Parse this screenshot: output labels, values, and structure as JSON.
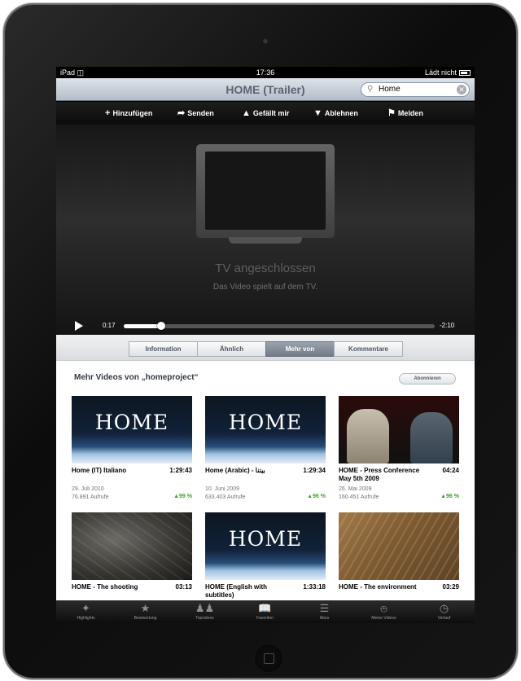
{
  "status": {
    "carrier": "iPad",
    "time": "17:36",
    "charging": "Lädt nicht"
  },
  "nav": {
    "title": "HOME (Trailer)",
    "search_value": "Home"
  },
  "actions": [
    "Hinzufügen",
    "Senden",
    "Gefällt mir",
    "Ablehnen",
    "Melden"
  ],
  "player": {
    "tv_title": "TV angeschlossen",
    "tv_subtitle": "Das Video spielt auf dem TV.",
    "elapsed": "0:17",
    "remaining": "-2:10",
    "progress": 0.12
  },
  "segments": {
    "labels": [
      "Information",
      "Ähnlich",
      "Mehr von",
      "Kommentare"
    ],
    "active": "Mehr von"
  },
  "section": {
    "title": "Mehr Videos von „homeproject“",
    "subscribe": "Abonnieren"
  },
  "videos": [
    {
      "thumb": "home",
      "thumb_text": "HOME",
      "title": "Home (IT)  Italiano",
      "duration": "1:29:43",
      "date": "29. Juli 2010",
      "views": "76.891 Aufrufe",
      "rating": "99 %"
    },
    {
      "thumb": "home",
      "thumb_text": "HOME",
      "title": "Home (Arabic) - بيتنا",
      "duration": "1:29:34",
      "date": "10. Juni 2009",
      "views": "633.403 Aufrufe",
      "rating": "96 %"
    },
    {
      "thumb": "press",
      "thumb_text": "",
      "title": "HOME - Press Conference May 5th 2009",
      "duration": "04:24",
      "date": "26. Mai 2009",
      "views": "160.451 Aufrufe",
      "rating": "96 %"
    },
    {
      "thumb": "city",
      "thumb_text": "",
      "title": "HOME - The shooting",
      "duration": "03:13",
      "date": "",
      "views": "",
      "rating": ""
    },
    {
      "thumb": "home",
      "thumb_text": "HOME",
      "title": "HOME (English with subtitles)",
      "duration": "1:33:18",
      "date": "",
      "views": "",
      "rating": ""
    },
    {
      "thumb": "env",
      "thumb_text": "",
      "title": "HOME - The environment",
      "duration": "03:29",
      "date": "",
      "views": "",
      "rating": ""
    }
  ],
  "tabs": [
    {
      "label": "Highlights",
      "icon": "highlights-icon"
    },
    {
      "label": "Bestwertung",
      "icon": "star-icon"
    },
    {
      "label": "Topvideos",
      "icon": "users-icon"
    },
    {
      "label": "Favoriten",
      "icon": "book-icon"
    },
    {
      "label": "Abos",
      "icon": "subscriptions-icon"
    },
    {
      "label": "Meine Videos",
      "icon": "upload-icon"
    },
    {
      "label": "Verlauf",
      "icon": "clock-icon"
    }
  ]
}
